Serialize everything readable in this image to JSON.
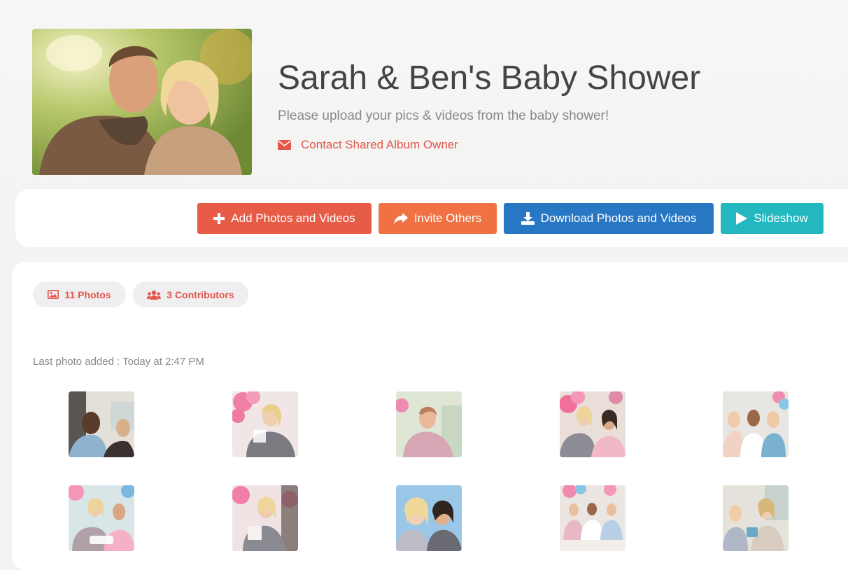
{
  "album": {
    "title": "Sarah & Ben's Baby Shower",
    "subtitle": "Please upload your pics & videos from the baby shower!",
    "contact_label": "Contact Shared Album Owner",
    "contact_icon": "envelope-icon",
    "cover_description": "cover-photo"
  },
  "toolbar": {
    "add_label": "Add Photos and Videos",
    "invite_label": "Invite Others",
    "download_label": "Download Photos and Videos",
    "slideshow_label": "Slideshow"
  },
  "stats": {
    "photos_label": "11 Photos",
    "contributors_label": "3 Contributors"
  },
  "last_added": "Last photo added : Today at 2:47 PM",
  "colors": {
    "accent": "#e2574c",
    "add_button": "#e65c47",
    "invite_button": "#f07244",
    "download_button": "#2877c4",
    "slideshow_button": "#23b7c0"
  }
}
